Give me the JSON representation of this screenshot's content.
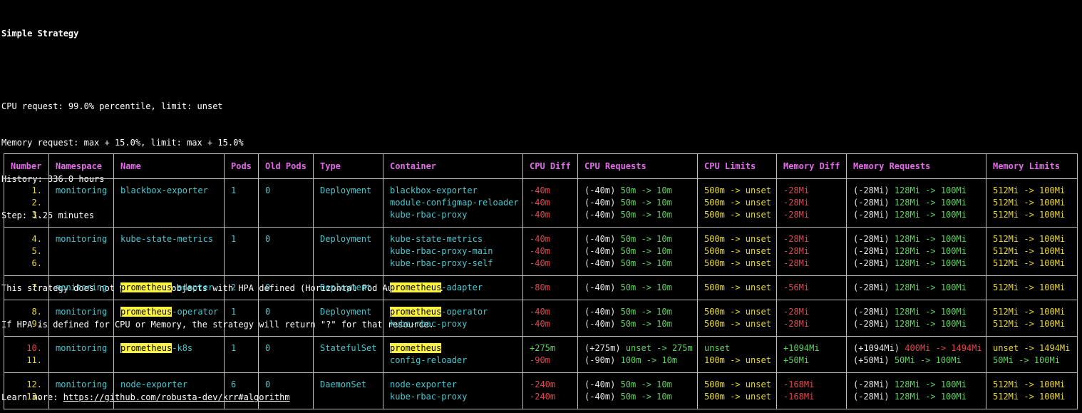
{
  "header": {
    "title": "Simple Strategy",
    "cpu_request": "CPU request: 99.0% percentile, limit: unset",
    "memory_request": "Memory request: max + 15.0%, limit: max + 15.0%",
    "history": "History: 336.0 hours",
    "step": "Step: 1.25 minutes",
    "hpa_note_1": "This strategy does not work with objects with HPA defined (Horizontal Pod Autoscaler).",
    "hpa_note_2": "If HPA is defined for CPU or Memory, the strategy will return \"?\" for that resource.",
    "learn_more_label": "Learn more: ",
    "learn_more_link": "https://github.com/robusta-dev/krr#algorithm"
  },
  "table": {
    "columns": [
      "Number",
      "Namespace",
      "Name",
      "Pods",
      "Old Pods",
      "Type",
      "Container",
      "CPU Diff",
      "CPU Requests",
      "CPU Limits",
      "Memory Diff",
      "Memory Requests",
      "Memory Limits"
    ],
    "search_highlight": "prometheus",
    "groups": [
      {
        "namespace": "monitoring",
        "name_pre": "",
        "name_hl": "",
        "name_post": "blackbox-exporter",
        "pods": "1",
        "old_pods": "0",
        "type": "Deployment",
        "rows": [
          {
            "number": "1.",
            "container_hl": "",
            "container": "blackbox-exporter",
            "cpu_diff": "-40m",
            "cpu_req_diff": "(-40m)",
            "cpu_req": "50m -> 10m",
            "cpu_lim": "500m -> unset",
            "mem_diff": "-28Mi",
            "mem_req_diff": "(-28Mi)",
            "mem_req": "128Mi -> 100Mi",
            "mem_lim": "512Mi -> 100Mi"
          },
          {
            "number": "2.",
            "container_hl": "",
            "container": "module-configmap-reloader",
            "cpu_diff": "-40m",
            "cpu_req_diff": "(-40m)",
            "cpu_req": "50m -> 10m",
            "cpu_lim": "500m -> unset",
            "mem_diff": "-28Mi",
            "mem_req_diff": "(-28Mi)",
            "mem_req": "128Mi -> 100Mi",
            "mem_lim": "512Mi -> 100Mi"
          },
          {
            "number": "3.",
            "container_hl": "",
            "container": "kube-rbac-proxy",
            "cpu_diff": "-40m",
            "cpu_req_diff": "(-40m)",
            "cpu_req": "50m -> 10m",
            "cpu_lim": "500m -> unset",
            "mem_diff": "-28Mi",
            "mem_req_diff": "(-28Mi)",
            "mem_req": "128Mi -> 100Mi",
            "mem_lim": "512Mi -> 100Mi"
          }
        ]
      },
      {
        "namespace": "monitoring",
        "name_pre": "",
        "name_hl": "",
        "name_post": "kube-state-metrics",
        "pods": "1",
        "old_pods": "0",
        "type": "Deployment",
        "rows": [
          {
            "number": "4.",
            "container_hl": "",
            "container": "kube-state-metrics",
            "cpu_diff": "-40m",
            "cpu_req_diff": "(-40m)",
            "cpu_req": "50m -> 10m",
            "cpu_lim": "500m -> unset",
            "mem_diff": "-28Mi",
            "mem_req_diff": "(-28Mi)",
            "mem_req": "128Mi -> 100Mi",
            "mem_lim": "512Mi -> 100Mi"
          },
          {
            "number": "5.",
            "container_hl": "",
            "container": "kube-rbac-proxy-main",
            "cpu_diff": "-40m",
            "cpu_req_diff": "(-40m)",
            "cpu_req": "50m -> 10m",
            "cpu_lim": "500m -> unset",
            "mem_diff": "-28Mi",
            "mem_req_diff": "(-28Mi)",
            "mem_req": "128Mi -> 100Mi",
            "mem_lim": "512Mi -> 100Mi"
          },
          {
            "number": "6.",
            "container_hl": "",
            "container": "kube-rbac-proxy-self",
            "cpu_diff": "-40m",
            "cpu_req_diff": "(-40m)",
            "cpu_req": "50m -> 10m",
            "cpu_lim": "500m -> unset",
            "mem_diff": "-28Mi",
            "mem_req_diff": "(-28Mi)",
            "mem_req": "128Mi -> 100Mi",
            "mem_lim": "512Mi -> 100Mi"
          }
        ]
      },
      {
        "namespace": "monitoring",
        "name_pre": "",
        "name_hl": "prometheus",
        "name_post": "-adapter",
        "pods": "2",
        "old_pods": "0",
        "type": "Deployment",
        "rows": [
          {
            "number": "7.",
            "container_hl": "prometheus",
            "container": "-adapter",
            "cpu_diff": "-80m",
            "cpu_req_diff": "(-40m)",
            "cpu_req": "50m -> 10m",
            "cpu_lim": "500m -> unset",
            "mem_diff": "-56Mi",
            "mem_req_diff": "(-28Mi)",
            "mem_req": "128Mi -> 100Mi",
            "mem_lim": "512Mi -> 100Mi"
          }
        ]
      },
      {
        "namespace": "monitoring",
        "name_pre": "",
        "name_hl": "prometheus",
        "name_post": "-operator",
        "pods": "1",
        "old_pods": "0",
        "type": "Deployment",
        "rows": [
          {
            "number": "8.",
            "container_hl": "prometheus",
            "container": "-operator",
            "cpu_diff": "-40m",
            "cpu_req_diff": "(-40m)",
            "cpu_req": "50m -> 10m",
            "cpu_lim": "500m -> unset",
            "mem_diff": "-28Mi",
            "mem_req_diff": "(-28Mi)",
            "mem_req": "128Mi -> 100Mi",
            "mem_lim": "512Mi -> 100Mi"
          },
          {
            "number": "9.",
            "container_hl": "",
            "container": "kube-rbac-proxy",
            "cpu_diff": "-40m",
            "cpu_req_diff": "(-40m)",
            "cpu_req": "50m -> 10m",
            "cpu_lim": "500m -> unset",
            "mem_diff": "-28Mi",
            "mem_req_diff": "(-28Mi)",
            "mem_req": "128Mi -> 100Mi",
            "mem_lim": "512Mi -> 100Mi"
          }
        ]
      },
      {
        "namespace": "monitoring",
        "name_pre": "",
        "name_hl": "prometheus",
        "name_post": "-k8s",
        "pods": "1",
        "old_pods": "0",
        "type": "StatefulSet",
        "rows": [
          {
            "number": "10.",
            "container_hl": "prometheus",
            "container": "",
            "cpu_diff": "+275m",
            "cpu_req_diff": "(+275m)",
            "cpu_req": "unset -> 275m",
            "cpu_lim": "unset",
            "mem_diff": "+1094Mi",
            "mem_req_diff": "(+1094Mi)",
            "mem_req": "400Mi -> 1494Mi",
            "mem_lim": "unset -> 1494Mi"
          },
          {
            "number": "11.",
            "container_hl": "",
            "container": "config-reloader",
            "cpu_diff": "-90m",
            "cpu_req_diff": "(-90m)",
            "cpu_req": "100m -> 10m",
            "cpu_lim": "100m -> unset",
            "mem_diff": "+50Mi",
            "mem_req_diff": "(+50Mi)",
            "mem_req": "50Mi -> 100Mi",
            "mem_lim": "50Mi -> 100Mi"
          }
        ]
      },
      {
        "namespace": "monitoring",
        "name_pre": "",
        "name_hl": "",
        "name_post": "node-exporter",
        "pods": "6",
        "old_pods": "0",
        "type": "DaemonSet",
        "rows": [
          {
            "number": "12.",
            "container_hl": "",
            "container": "node-exporter",
            "cpu_diff": "-240m",
            "cpu_req_diff": "(-40m)",
            "cpu_req": "50m -> 10m",
            "cpu_lim": "500m -> unset",
            "mem_diff": "-168Mi",
            "mem_req_diff": "(-28Mi)",
            "mem_req": "128Mi -> 100Mi",
            "mem_lim": "512Mi -> 100Mi"
          },
          {
            "number": "13.",
            "container_hl": "",
            "container": "kube-rbac-proxy",
            "cpu_diff": "-240m",
            "cpu_req_diff": "(-40m)",
            "cpu_req": "50m -> 10m",
            "cpu_lim": "500m -> unset",
            "mem_diff": "-168Mi",
            "mem_req_diff": "(-28Mi)",
            "mem_req": "128Mi -> 100Mi",
            "mem_lim": "512Mi -> 100Mi"
          }
        ]
      }
    ]
  },
  "colors": {
    "header_magenta": "#e26ce8",
    "number_yellow": "#e8d83a",
    "number_red": "#e2474b",
    "cyan": "#48c8d0",
    "green": "#5fd35f",
    "red": "#e2474b",
    "yellow": "#e8d83a",
    "highlight": "#fcf340"
  }
}
